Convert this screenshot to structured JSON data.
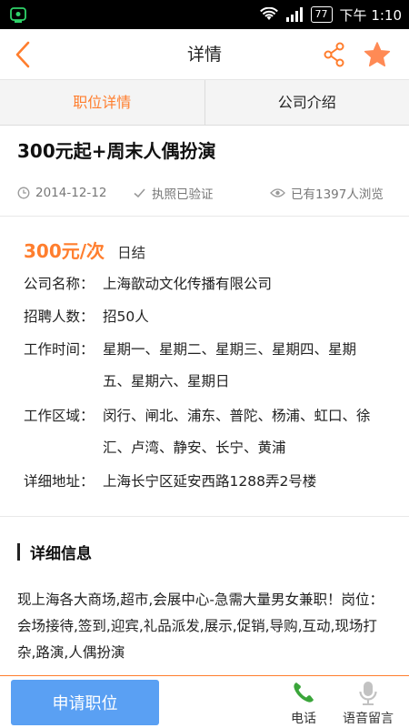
{
  "status_bar": {
    "battery": "77",
    "time": "下午 1:10"
  },
  "header": {
    "title": "详情"
  },
  "tabs": [
    {
      "label": "职位详情",
      "active": true
    },
    {
      "label": "公司介绍",
      "active": false
    }
  ],
  "job": {
    "title": "300元起+周末人偶扮演",
    "date": "2014-12-12",
    "verified": "执照已验证",
    "views": "已有1397人浏览",
    "salary": "300元/次",
    "settlement": "日结",
    "info": [
      {
        "label": "公司名称：",
        "value": "上海歆动文化传播有限公司"
      },
      {
        "label": "招聘人数：",
        "value": "招50人"
      },
      {
        "label": "工作时间：",
        "value": "星期一、星期二、星期三、星期四、星期五、星期六、星期日"
      },
      {
        "label": "工作区域：",
        "value": "闵行、闸北、浦东、普陀、杨浦、虹口、徐汇、卢湾、静安、长宁、黄浦"
      },
      {
        "label": "详细地址：",
        "value": "上海长宁区延安西路1288弄2号楼"
      }
    ]
  },
  "details": {
    "heading": "详细信息",
    "text": "现上海各大商场,超市,会展中心-急需大量男女兼职！岗位：会场接待,签到,迎宾,礼品派发,展示,促销,导购,互动,现场打杂,路演,人偶扮演"
  },
  "bottom": {
    "apply_label": "申请职位",
    "phone_label": "电话",
    "voice_label": "语音留言"
  },
  "colors": {
    "accent": "#ff7e2e",
    "apply_button": "#5aa0f3",
    "phone_green": "#3aa53a"
  },
  "icons": [
    "app-notification-icon",
    "wifi-icon",
    "signal-icon",
    "back-icon",
    "share-icon",
    "star-icon",
    "clock-icon",
    "check-icon",
    "eye-icon",
    "phone-icon",
    "microphone-icon"
  ]
}
